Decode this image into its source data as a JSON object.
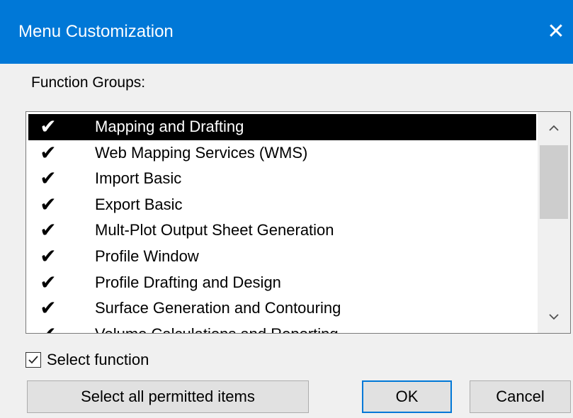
{
  "window": {
    "title": "Menu Customization",
    "close_symbol": "✕",
    "accent_color": "#0078d7"
  },
  "function_groups": {
    "label": "Function Groups:",
    "items": [
      {
        "label": "Mapping and Drafting",
        "checked": true,
        "selected": true,
        "check_symbol": "✔"
      },
      {
        "label": "Web Mapping Services (WMS)",
        "checked": true,
        "check_symbol": "✔"
      },
      {
        "label": "Import Basic",
        "checked": true,
        "check_symbol": "✔"
      },
      {
        "label": "Export Basic",
        "checked": true,
        "check_symbol": "✔"
      },
      {
        "label": "Mult-Plot Output Sheet Generation",
        "checked": true,
        "check_symbol": "✔"
      },
      {
        "label": "Profile Window",
        "checked": true,
        "check_symbol": "✔"
      },
      {
        "label": "Profile Drafting and Design",
        "checked": true,
        "check_symbol": "✔"
      },
      {
        "label": "Surface Generation and Contouring",
        "checked": true,
        "check_symbol": "✔"
      },
      {
        "label": "Volume Calculations and Reporting",
        "checked": true,
        "check_symbol": "✔"
      }
    ],
    "scrollbar": {
      "up_icon": "chevron-up-icon",
      "down_icon": "chevron-down-icon"
    }
  },
  "select_function": {
    "label": "Select function",
    "checked": true
  },
  "buttons": {
    "select_all": "Select all permitted items",
    "ok": "OK",
    "cancel": "Cancel"
  }
}
